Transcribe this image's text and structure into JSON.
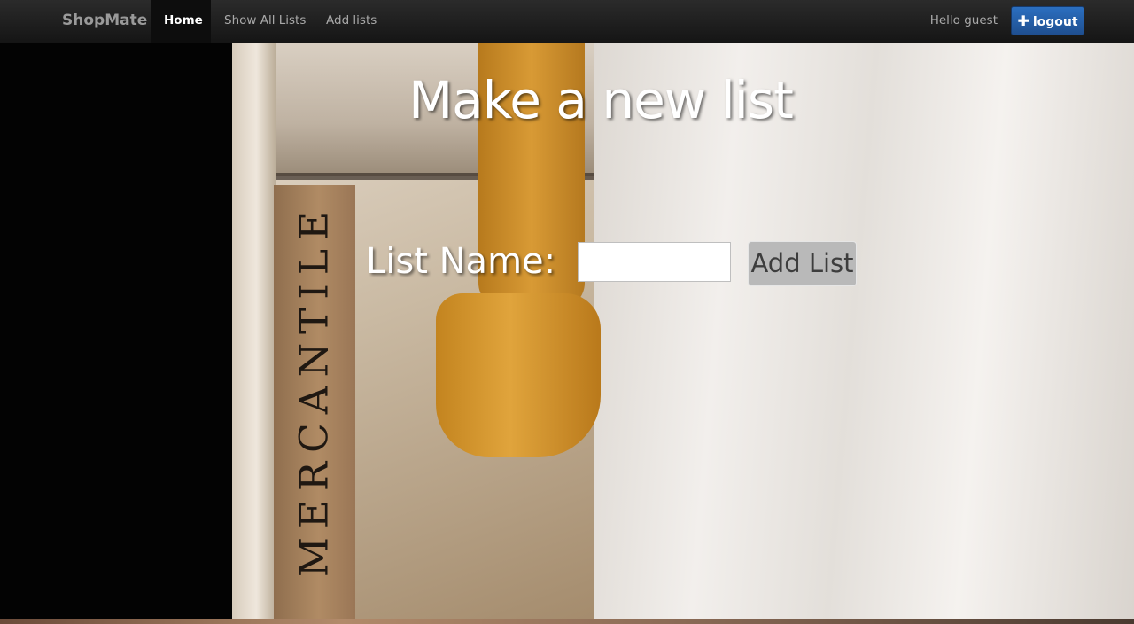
{
  "navbar": {
    "brand": "ShopMate",
    "items": [
      {
        "label": "Home"
      },
      {
        "label": "Show All Lists"
      },
      {
        "label": "Add lists"
      }
    ],
    "greeting": "Hello guest",
    "logout_label": "logout",
    "logout_icon": "plus-icon"
  },
  "background": {
    "stamp_text": "MERCANTILE"
  },
  "page": {
    "title": "Make a new list",
    "form": {
      "label": "List Name:",
      "input_value": "",
      "input_placeholder": "",
      "submit_label": "Add List"
    }
  },
  "colors": {
    "navbar": "#1c1c1c",
    "logout_button": "#2a64b0",
    "add_button": "#b9b9b9"
  }
}
